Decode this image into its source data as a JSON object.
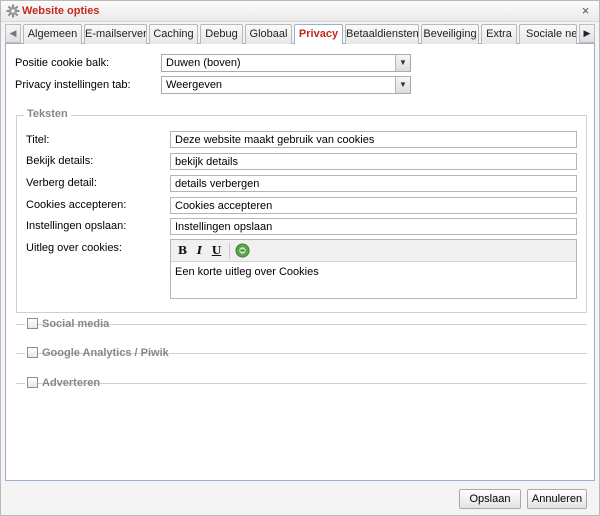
{
  "window": {
    "title": "Website opties"
  },
  "tabs": [
    {
      "label": "Algemeen"
    },
    {
      "label": "E-mailserver"
    },
    {
      "label": "Caching"
    },
    {
      "label": "Debug"
    },
    {
      "label": "Globaal"
    },
    {
      "label": "Privacy",
      "active": true
    },
    {
      "label": "Betaaldiensten"
    },
    {
      "label": "Beveiliging"
    },
    {
      "label": "Extra"
    },
    {
      "label": "Sociale netwe"
    }
  ],
  "settings": {
    "cookie_bar_position": {
      "label": "Positie cookie balk:",
      "value": "Duwen (boven)"
    },
    "privacy_tab": {
      "label": "Privacy instellingen tab:",
      "value": "Weergeven"
    }
  },
  "texts_section": {
    "legend": "Teksten",
    "fields": [
      {
        "label": "Titel:",
        "value": "Deze website maakt gebruik van cookies"
      },
      {
        "label": "Bekijk details:",
        "value": "bekijk details"
      },
      {
        "label": "Verberg detail:",
        "value": "details verbergen"
      },
      {
        "label": "Cookies accepteren:",
        "value": "Cookies accepteren"
      },
      {
        "label": "Instellingen opslaan:",
        "value": "Instellingen opslaan"
      }
    ],
    "explanation": {
      "label": "Uitleg over cookies:",
      "toolbar": {
        "bold": "B",
        "italic": "I",
        "underline": "U"
      },
      "value": "Een korte uitleg over Cookies"
    }
  },
  "collapsed_sections": [
    {
      "label": "Social media"
    },
    {
      "label": "Google Analytics / Piwik"
    },
    {
      "label": "Adverteren"
    }
  ],
  "footer": {
    "save_label": "Opslaan",
    "cancel_label": "Annuleren"
  },
  "colors": {
    "accent": "#c4291b",
    "panel_border": "#9ab0cf"
  }
}
